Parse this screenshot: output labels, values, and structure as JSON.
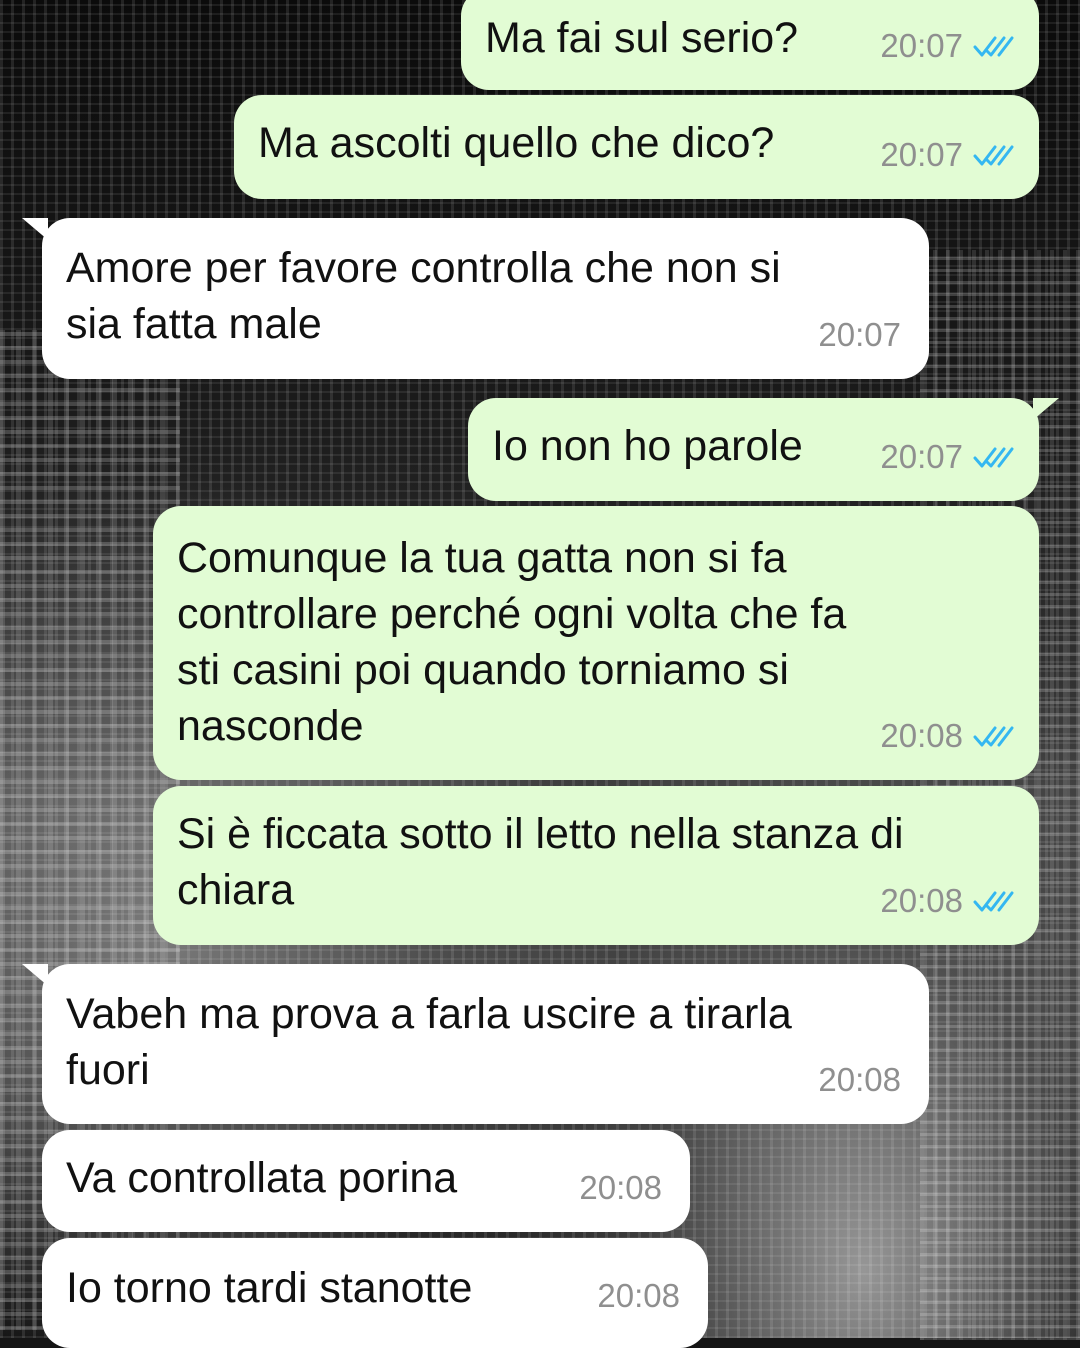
{
  "colors": {
    "outgoing_bubble": "#e2fcd4",
    "incoming_bubble": "#ffffff",
    "read_ticks": "#34b7f1",
    "timestamp": "#8f8f8f"
  },
  "messages": [
    {
      "direction": "outgoing",
      "text": "Ma fai sul serio?",
      "time": "20:07",
      "status": "read",
      "status_icon": "double-check-icon"
    },
    {
      "direction": "outgoing",
      "text": "Ma ascolti quello che dico?",
      "time": "20:07",
      "status": "read",
      "status_icon": "double-check-icon"
    },
    {
      "direction": "incoming",
      "text": "Amore per favore controlla che non si\nsia fatta male",
      "time": "20:07"
    },
    {
      "direction": "outgoing",
      "text": "Io non ho parole",
      "time": "20:07",
      "status": "read",
      "status_icon": "double-check-icon"
    },
    {
      "direction": "outgoing",
      "text": "Comunque la tua gatta non si fa\ncontrollare perché ogni volta che fa\nsti casini poi quando torniamo si\nnasconde",
      "time": "20:08",
      "status": "read",
      "status_icon": "double-check-icon"
    },
    {
      "direction": "outgoing",
      "text": "Si è ficcata sotto il letto nella stanza di\nchiara",
      "time": "20:08",
      "status": "read",
      "status_icon": "double-check-icon"
    },
    {
      "direction": "incoming",
      "text": "Vabeh ma prova a farla uscire a tirarla\nfuori",
      "time": "20:08"
    },
    {
      "direction": "incoming",
      "text": "Va controllata porina",
      "time": "20:08"
    },
    {
      "direction": "incoming",
      "text": "Io torno tardi stanotte",
      "time": "20:08"
    }
  ]
}
